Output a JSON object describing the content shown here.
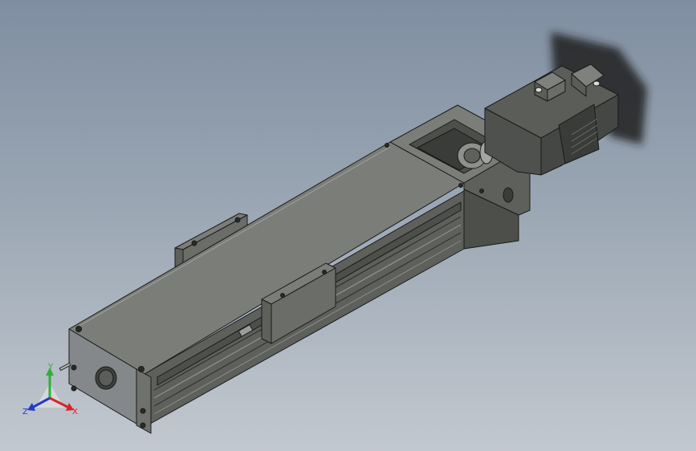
{
  "viewport": {
    "background_top": "#7f8ea1",
    "background_bottom": "#c2c8cf"
  },
  "model": {
    "body_color": "#6b6e68",
    "top_color": "#7b7e78",
    "side_color": "#5e615b",
    "end_color": "#85888a",
    "motor_color": "#4e514d",
    "motor_shadow_color": "#1e1f1e"
  },
  "triad": {
    "x_label": "X",
    "y_label": "Y",
    "z_label": "Z",
    "x_color": "#d8242a",
    "y_color": "#2fae3a",
    "z_color": "#2339c8"
  }
}
